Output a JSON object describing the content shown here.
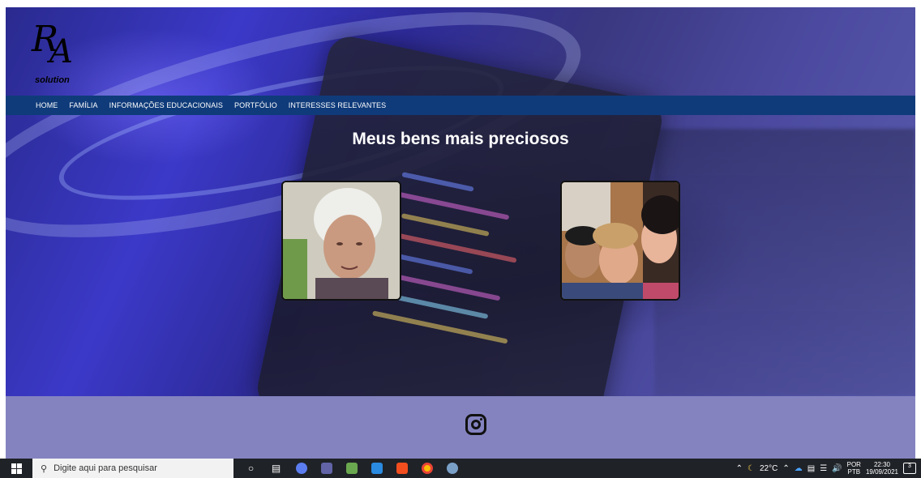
{
  "logo": {
    "letter1": "R",
    "letter2": "A",
    "subtitle": "solution"
  },
  "nav": [
    {
      "label": "HOME"
    },
    {
      "label": "FAMÍLIA"
    },
    {
      "label": "INFORMAÇÕES EDUCACIONAIS"
    },
    {
      "label": "PORTFÓLIO"
    },
    {
      "label": "INTERESSES RELEVANTES"
    }
  ],
  "main": {
    "heading": "Meus bens mais preciosos"
  },
  "colors": {
    "navbar": "#0f3b7a",
    "footer": "#8483c0",
    "taskbar": "#1f2227"
  },
  "footer": {
    "icon": "instagram-icon"
  },
  "taskbar": {
    "search_placeholder": "Digite aqui para pesquisar",
    "weather": "22°C",
    "language_line1": "POR",
    "language_line2": "PTB",
    "time": "22:30",
    "date": "19/09/2021",
    "notifications": "3"
  }
}
